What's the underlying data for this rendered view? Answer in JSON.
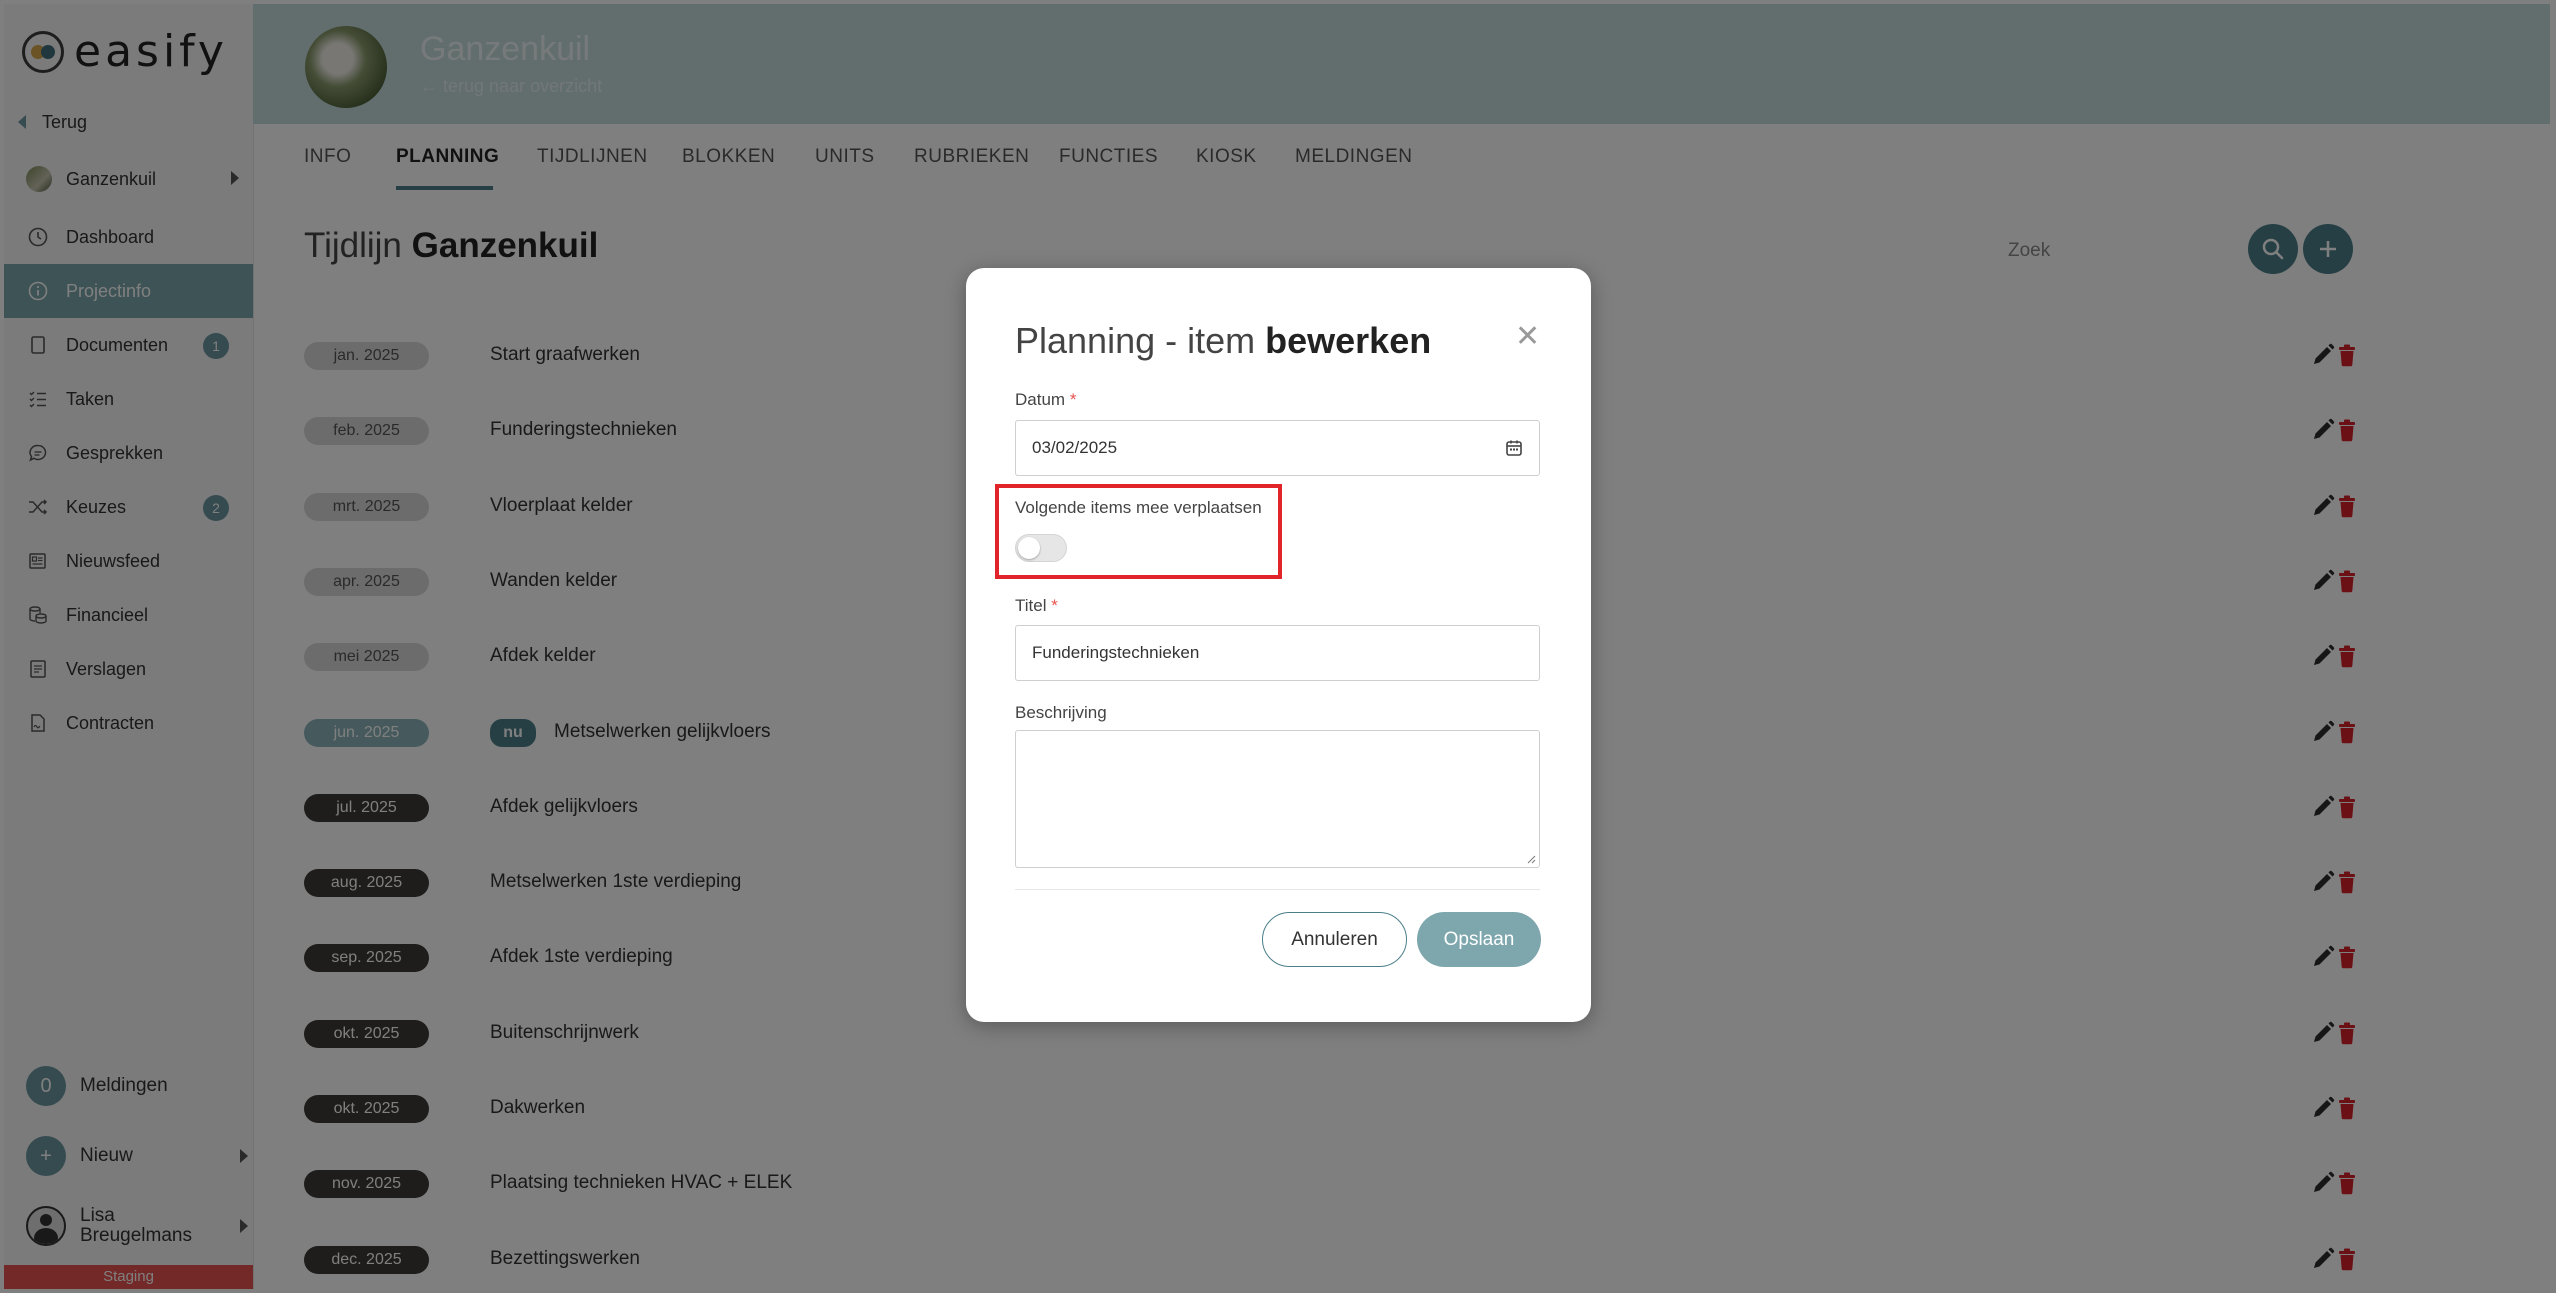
{
  "app": {
    "logo_text": "easify",
    "staging_label": "Staging"
  },
  "sidebar": {
    "back_label": "Terug",
    "project_label": "Ganzenkuil",
    "items": [
      {
        "label": "Dashboard",
        "icon": "clock-icon"
      },
      {
        "label": "Projectinfo",
        "icon": "info-icon",
        "active": true
      },
      {
        "label": "Documenten",
        "icon": "document-icon",
        "badge": "1"
      },
      {
        "label": "Taken",
        "icon": "tasks-icon"
      },
      {
        "label": "Gesprekken",
        "icon": "chat-icon"
      },
      {
        "label": "Keuzes",
        "icon": "shuffle-icon",
        "badge": "2"
      },
      {
        "label": "Nieuwsfeed",
        "icon": "newspaper-icon"
      },
      {
        "label": "Financieel",
        "icon": "coins-icon"
      },
      {
        "label": "Verslagen",
        "icon": "report-icon"
      },
      {
        "label": "Contracten",
        "icon": "contract-icon"
      }
    ],
    "notifications": {
      "count": "0",
      "label": "Meldingen"
    },
    "new_label": "Nieuw",
    "user": {
      "first": "Lisa",
      "last": "Breugelmans"
    }
  },
  "header": {
    "project_title": "Ganzenkuil",
    "back_link": "terug naar overzicht"
  },
  "tabs": [
    "INFO",
    "PLANNING",
    "TIJDLIJNEN",
    "BLOKKEN",
    "UNITS",
    "RUBRIEKEN",
    "FUNCTIES",
    "KIOSK",
    "MELDINGEN"
  ],
  "page": {
    "title_prefix": "Tijdlijn",
    "title_name": "Ganzenkuil",
    "search_placeholder": "Zoek"
  },
  "timeline": [
    {
      "date": "jan. 2025",
      "title": "Start graafwerken",
      "state": "past"
    },
    {
      "date": "feb. 2025",
      "title": "Funderingstechnieken",
      "state": "past"
    },
    {
      "date": "mrt. 2025",
      "title": "Vloerplaat kelder",
      "state": "past"
    },
    {
      "date": "apr. 2025",
      "title": "Wanden kelder",
      "state": "past"
    },
    {
      "date": "mei 2025",
      "title": "Afdek kelder",
      "state": "past"
    },
    {
      "date": "jun. 2025",
      "title": "Metselwerken gelijkvloers",
      "state": "now",
      "now_label": "nu"
    },
    {
      "date": "jul. 2025",
      "title": "Afdek gelijkvloers",
      "state": "future"
    },
    {
      "date": "aug. 2025",
      "title": "Metselwerken 1ste verdieping",
      "state": "future"
    },
    {
      "date": "sep. 2025",
      "title": "Afdek 1ste verdieping",
      "state": "future"
    },
    {
      "date": "okt. 2025",
      "title": "Buitenschrijnwerk",
      "state": "future"
    },
    {
      "date": "okt. 2025",
      "title": "Dakwerken",
      "state": "future"
    },
    {
      "date": "nov. 2025",
      "title": "Plaatsing technieken HVAC + ELEK",
      "state": "future"
    },
    {
      "date": "dec. 2025",
      "title": "Bezettingswerken",
      "state": "future"
    }
  ],
  "modal": {
    "title_prefix": "Planning - item",
    "title_bold": "bewerken",
    "date_label": "Datum",
    "date_value": "03/02/2025",
    "toggle_label": "Volgende items mee verplaatsen",
    "toggle_on": false,
    "title_label": "Titel",
    "title_value": "Funderingstechnieken",
    "description_label": "Beschrijving",
    "description_value": "",
    "required_mark": "*",
    "cancel_label": "Annuleren",
    "save_label": "Opslaan"
  },
  "colors": {
    "accent": "#4a7f89",
    "accent_light": "#7da6ad",
    "danger": "#e0242a",
    "staging": "#e7534e"
  }
}
